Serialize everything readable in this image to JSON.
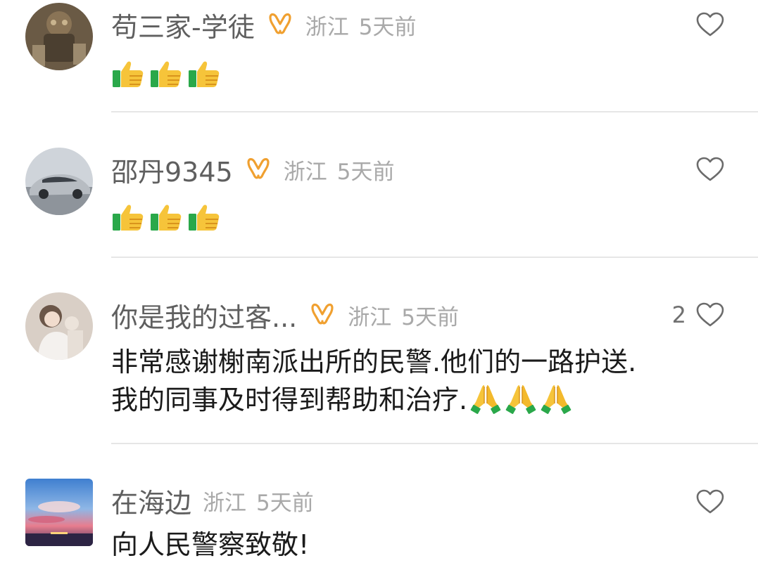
{
  "comments": [
    {
      "username": "苟三家-学徒",
      "badge_icon": "ribbon-badge-icon",
      "location": "浙江",
      "time": "5天前",
      "like_count": "",
      "content_emojis": [
        "thumbs-up-icon",
        "thumbs-up-icon",
        "thumbs-up-icon"
      ]
    },
    {
      "username": "邵丹9345",
      "badge_icon": "ribbon-badge-icon",
      "location": "浙江",
      "time": "5天前",
      "like_count": "",
      "content_emojis": [
        "thumbs-up-icon",
        "thumbs-up-icon",
        "thumbs-up-icon"
      ]
    },
    {
      "username": "你是我的过客...",
      "badge_icon": "ribbon-badge-icon",
      "location": "浙江",
      "time": "5天前",
      "like_count": "2",
      "content_line1": "非常感谢榭南派出所的民警.他们的一路护送.",
      "content_line2": "我的同事及时得到帮助和治疗.",
      "content_emojis": [
        "praying-hands-icon",
        "praying-hands-icon",
        "praying-hands-icon"
      ]
    },
    {
      "username": "在海边",
      "location": "浙江",
      "time": "5天前",
      "like_count": "",
      "content_text": "向人民警察致敬!"
    }
  ],
  "colors": {
    "username": "#5f5f5f",
    "meta": "#a9a9a9",
    "content": "#1b1b1b",
    "badge": "#f0a030",
    "divider": "#e6e6e6"
  }
}
